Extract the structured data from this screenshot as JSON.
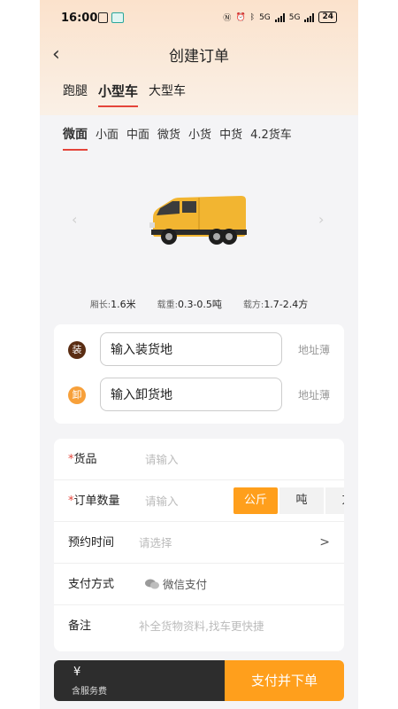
{
  "status_bar": {
    "time": "16:00",
    "network": "5G",
    "battery": "24"
  },
  "header": {
    "title": "创建订单"
  },
  "category_tabs": [
    {
      "label": "跑腿",
      "active": false
    },
    {
      "label": "小型车",
      "active": true
    },
    {
      "label": "大型车",
      "active": false
    }
  ],
  "vehicle_tabs": [
    {
      "label": "微面",
      "active": true
    },
    {
      "label": "小面",
      "active": false
    },
    {
      "label": "中面",
      "active": false
    },
    {
      "label": "微货",
      "active": false
    },
    {
      "label": "小货",
      "active": false
    },
    {
      "label": "中货",
      "active": false
    },
    {
      "label": "4.2货车",
      "active": false
    }
  ],
  "vehicle_specs": {
    "length_label": "厢长:",
    "length_value": "1.6米",
    "weight_label": "载重:",
    "weight_value": "0.3-0.5吨",
    "volume_label": "载方:",
    "volume_value": "1.7-2.4方"
  },
  "addresses": {
    "load": {
      "badge": "装",
      "placeholder": "输入装货地",
      "book": "地址薄",
      "color": "#5a2d13"
    },
    "unload": {
      "badge": "卸",
      "placeholder": "输入卸货地",
      "book": "地址薄",
      "color": "#f7a03a"
    }
  },
  "form": {
    "goods": {
      "label": "货品",
      "placeholder": "请输入"
    },
    "quantity": {
      "label": "订单数量",
      "placeholder": "请输入",
      "units": [
        "公斤",
        "吨",
        "方"
      ],
      "selected_unit": "公斤"
    },
    "time": {
      "label": "预约时间",
      "placeholder": "请选择"
    },
    "payment": {
      "label": "支付方式",
      "value": "微信支付"
    },
    "note": {
      "label": "备注",
      "placeholder": "补全货物资料,找车更快捷"
    }
  },
  "footer": {
    "currency": "¥",
    "fee_label": "含服务费",
    "submit_label": "支付并下单"
  },
  "colors": {
    "accent": "#ff9f1c",
    "active_underline": "#e4443a"
  }
}
